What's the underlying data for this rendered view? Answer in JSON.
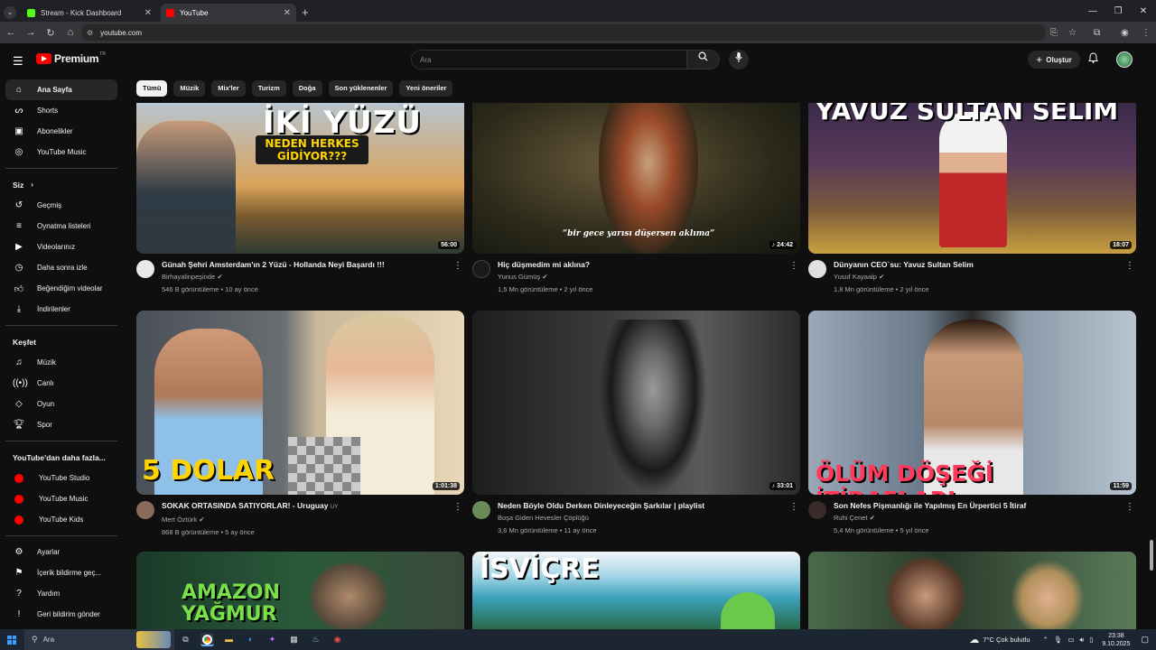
{
  "browser": {
    "tabs": [
      {
        "title": "Stream - Kick Dashboard",
        "favicon_color": "#53fc18"
      },
      {
        "title": "YouTube",
        "favicon_color": "#ff0000"
      }
    ],
    "url": "youtube.com"
  },
  "header": {
    "logo_text": "Premium",
    "logo_region": "TR",
    "search_placeholder": "Ara",
    "create_label": "Oluştur"
  },
  "chips": [
    "Tümü",
    "Müzik",
    "Mix'ler",
    "Turizm",
    "Doğa",
    "Son yüklenenler",
    "Yeni öneriler"
  ],
  "sidebar": {
    "main": [
      {
        "label": "Ana Sayfa",
        "icon": "home-icon"
      },
      {
        "label": "Shorts",
        "icon": "shorts-icon"
      },
      {
        "label": "Abonelikler",
        "icon": "subscriptions-icon"
      },
      {
        "label": "YouTube Music",
        "icon": "music-circle-icon"
      }
    ],
    "you_heading": "Siz",
    "you": [
      {
        "label": "Geçmiş",
        "icon": "history-icon"
      },
      {
        "label": "Oynatma listeleri",
        "icon": "playlist-icon"
      },
      {
        "label": "Videolarınız",
        "icon": "your-videos-icon"
      },
      {
        "label": "Daha sonra izle",
        "icon": "watch-later-icon"
      },
      {
        "label": "Beğendiğim videolar",
        "icon": "thumbs-up-icon"
      },
      {
        "label": "İndirilenler",
        "icon": "download-icon"
      }
    ],
    "explore_heading": "Keşfet",
    "explore": [
      {
        "label": "Müzik",
        "icon": "music-note-icon"
      },
      {
        "label": "Canlı",
        "icon": "live-icon"
      },
      {
        "label": "Oyun",
        "icon": "gaming-icon"
      },
      {
        "label": "Spor",
        "icon": "trophy-icon"
      }
    ],
    "more_heading": "YouTube'dan daha fazla...",
    "more": [
      {
        "label": "YouTube Studio"
      },
      {
        "label": "YouTube Music"
      },
      {
        "label": "YouTube Kids"
      }
    ],
    "settings": [
      {
        "label": "Ayarlar",
        "icon": "gear-icon"
      },
      {
        "label": "İçerik bildirme geç...",
        "icon": "flag-icon"
      },
      {
        "label": "Yardım",
        "icon": "help-icon"
      },
      {
        "label": "Geri bildirim gönder",
        "icon": "feedback-icon"
      }
    ]
  },
  "videos": [
    {
      "title": "Günah Şehri Amsterdam'ın 2 Yüzü - Hollanda Neyi Başardı !!!",
      "channel": "Birhayalinpeşinde",
      "stats": "546 B görüntüleme • 10 ay önce",
      "duration": "56:00",
      "thumb_text": "İKİ YÜZÜ",
      "thumb_subtext": "NEDEN HERKES GİDİYOR???"
    },
    {
      "title": "Hiç düşmedim mi aklına?",
      "channel": "Yunus Gümüş",
      "stats": "1,5 Mn görüntüleme • 2 yıl önce",
      "duration": "24:42",
      "thumb_text": "“bir gece yarısı düşersen aklıma”"
    },
    {
      "title": "Dünyanın CEO`su: Yavuz Sultan Selim",
      "channel": "Yusuf Kayaalp",
      "stats": "1,8 Mn görüntüleme • 2 yıl önce",
      "duration": "18:07",
      "thumb_text": "YAVUZ SULTAN SELİM"
    },
    {
      "title": "SOKAK ORTASINDA SATIYORLAR! - Uruguay",
      "title_suffix": "UY",
      "channel": "Mert Öztürk",
      "stats": "868 B görüntüleme • 5 ay önce",
      "duration": "1:01:38",
      "thumb_text": "5 DOLAR"
    },
    {
      "title": "Neden Böyle Oldu Derken Dinleyeceğin Şarkılar | playlist",
      "channel": "Boşa Giden Hevesler Çöplüğü",
      "stats": "3,6 Mn görüntüleme • 11 ay önce",
      "duration": "33:01"
    },
    {
      "title": "Son Nefes Pişmanlığı ile Yapılmış En Ürpertici 5 İtiraf",
      "channel": "Ruhi Çenet",
      "stats": "5,4 Mn görüntüleme • 5 yıl önce",
      "duration": "11:59",
      "thumb_text": "ÖLÜM DÖŞEĞİ İTİRAFLARI"
    },
    {
      "thumb_text": "AMAZON YAĞMUR"
    },
    {
      "thumb_text": "İSVİÇRE"
    },
    {}
  ],
  "taskbar": {
    "search_placeholder": "Ara",
    "weather": "7°C  Çok bulutlu",
    "time": "23:38",
    "date": "9.10.2025"
  }
}
